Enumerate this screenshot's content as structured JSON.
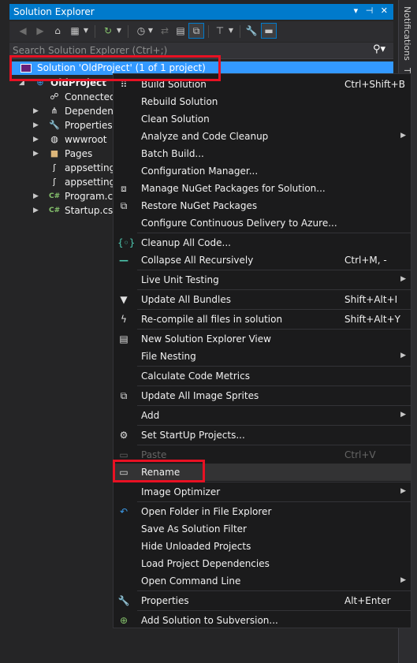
{
  "window": {
    "title": "Solution Explorer",
    "controls": "▾ ⊣ ✕"
  },
  "search": {
    "placeholder": "Search Solution Explorer (Ctrl+;)",
    "icon": "search-icon"
  },
  "side_tabs": {
    "notifications": "Notifications",
    "second": "T"
  },
  "tree": {
    "solution_label": "Solution 'OldProject' (1 of 1 project)",
    "items": [
      {
        "label": "OldProject",
        "icon": "web-project-icon"
      },
      {
        "label": "Connected",
        "icon": "connected-services-icon"
      },
      {
        "label": "Dependenc",
        "icon": "dependencies-icon"
      },
      {
        "label": "Properties",
        "icon": "wrench-icon"
      },
      {
        "label": "wwwroot",
        "icon": "globe-icon"
      },
      {
        "label": "Pages",
        "icon": "folder-icon"
      },
      {
        "label": "appsettings",
        "icon": "json-file-icon"
      },
      {
        "label": "appsettings",
        "icon": "json-file-icon"
      },
      {
        "label": "Program.cs",
        "icon": "csharp-file-icon"
      },
      {
        "label": "Startup.cs",
        "icon": "csharp-file-icon"
      }
    ]
  },
  "menu": {
    "items": [
      {
        "label": "Build Solution",
        "shortcut": "Ctrl+Shift+B"
      },
      {
        "label": "Rebuild Solution",
        "shortcut": ""
      },
      {
        "label": "Clean Solution",
        "shortcut": ""
      },
      {
        "label": "Analyze and Code Cleanup",
        "shortcut": ""
      },
      {
        "label": "Batch Build...",
        "shortcut": ""
      },
      {
        "label": "Configuration Manager...",
        "shortcut": ""
      },
      {
        "label": "Manage NuGet Packages for Solution...",
        "shortcut": ""
      },
      {
        "label": "Restore NuGet Packages",
        "shortcut": ""
      },
      {
        "label": "Configure Continuous Delivery to Azure...",
        "shortcut": ""
      },
      {
        "label": "Cleanup All Code...",
        "shortcut": ""
      },
      {
        "label": "Collapse All Recursively",
        "shortcut": "Ctrl+M, -"
      },
      {
        "label": "Live Unit Testing",
        "shortcut": ""
      },
      {
        "label": "Update All Bundles",
        "shortcut": "Shift+Alt+I"
      },
      {
        "label": "Re-compile all files in solution",
        "shortcut": "Shift+Alt+Y"
      },
      {
        "label": "New Solution Explorer View",
        "shortcut": ""
      },
      {
        "label": "File Nesting",
        "shortcut": ""
      },
      {
        "label": "Calculate Code Metrics",
        "shortcut": ""
      },
      {
        "label": "Update All Image Sprites",
        "shortcut": ""
      },
      {
        "label": "Add",
        "shortcut": ""
      },
      {
        "label": "Set StartUp Projects...",
        "shortcut": ""
      },
      {
        "label": "Paste",
        "shortcut": "Ctrl+V"
      },
      {
        "label": "Rename",
        "shortcut": ""
      },
      {
        "label": "Image Optimizer",
        "shortcut": ""
      },
      {
        "label": "Open Folder in File Explorer",
        "shortcut": ""
      },
      {
        "label": "Save As Solution Filter",
        "shortcut": ""
      },
      {
        "label": "Hide Unloaded Projects",
        "shortcut": ""
      },
      {
        "label": "Load Project Dependencies",
        "shortcut": ""
      },
      {
        "label": "Open Command Line",
        "shortcut": ""
      },
      {
        "label": "Properties",
        "shortcut": "Alt+Enter"
      },
      {
        "label": "Add Solution to Subversion...",
        "shortcut": ""
      }
    ]
  },
  "colors": {
    "accent": "#007acc",
    "selection": "#3399ff",
    "highlight_box": "#e81123",
    "menu_bg": "#1b1b1c"
  }
}
